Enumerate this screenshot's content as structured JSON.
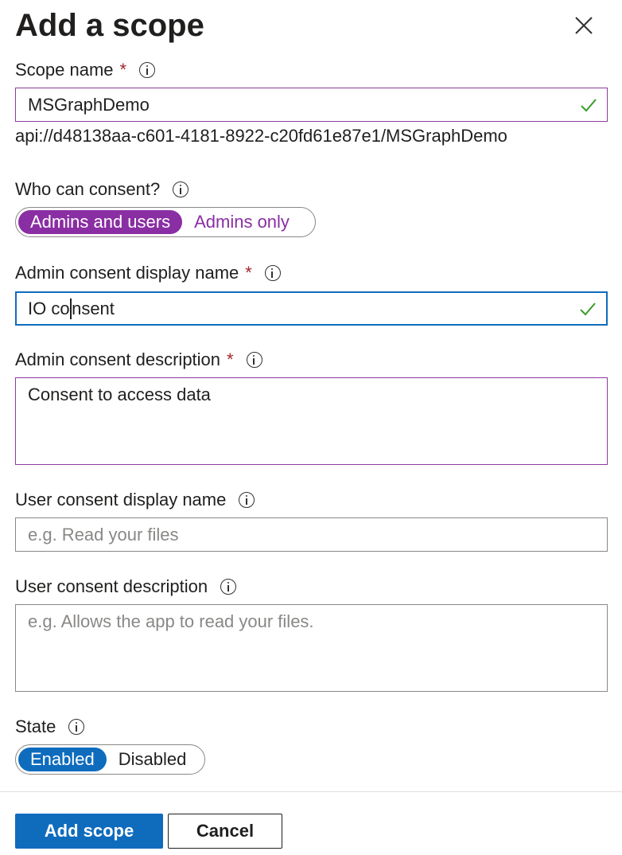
{
  "panel": {
    "title": "Add a scope"
  },
  "scope_name": {
    "label": "Scope name",
    "required_marker": "*",
    "value": "MSGraphDemo",
    "uri": "api://d48138aa-c601-4181-8922-c20fd61e87e1/MSGraphDemo"
  },
  "who_can_consent": {
    "label": "Who can consent?",
    "options": [
      "Admins and users",
      "Admins only"
    ],
    "selected": "Admins and users"
  },
  "admin_display_name": {
    "label": "Admin consent display name",
    "required_marker": "*",
    "value_before_cursor": "IO co",
    "value_after_cursor": "nsent"
  },
  "admin_description": {
    "label": "Admin consent description",
    "required_marker": "*",
    "value": "Consent to access data"
  },
  "user_display_name": {
    "label": "User consent display name",
    "placeholder": "e.g. Read your files"
  },
  "user_description": {
    "label": "User consent description",
    "placeholder": "e.g. Allows the app to read your files."
  },
  "state": {
    "label": "State",
    "options": [
      "Enabled",
      "Disabled"
    ],
    "selected": "Enabled"
  },
  "footer": {
    "add_label": "Add scope",
    "cancel_label": "Cancel"
  },
  "colors": {
    "accent_blue": "#0f6cbd",
    "accent_purple": "#8a2ea3",
    "required_red": "#a4262c",
    "valid_green": "#3a9c2a"
  }
}
